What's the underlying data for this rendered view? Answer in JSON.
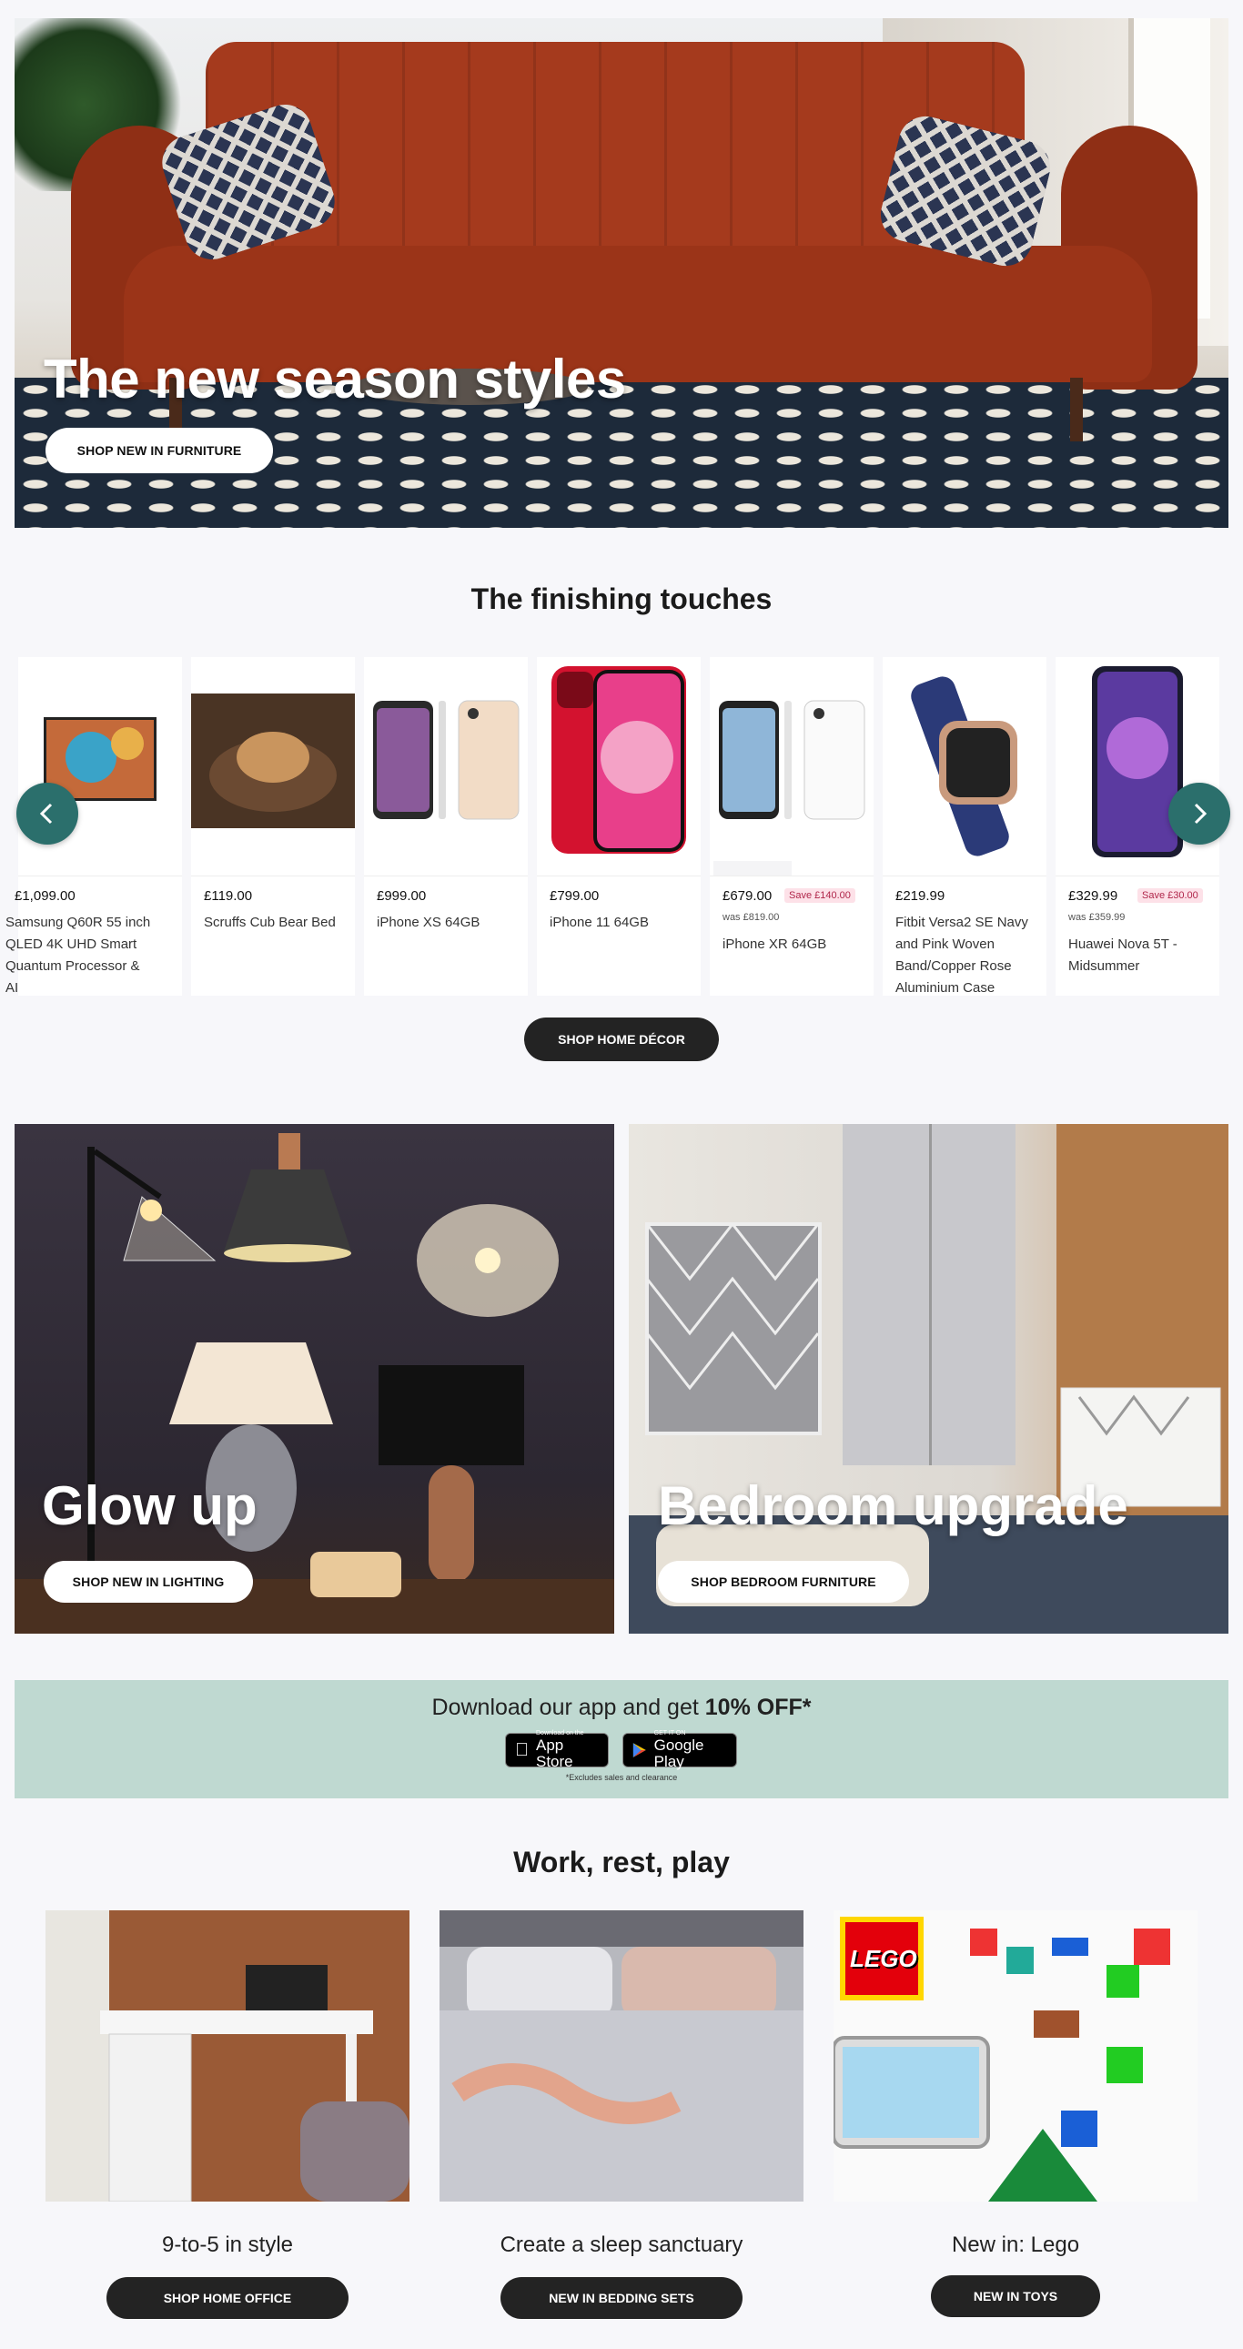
{
  "hero": {
    "heading": "The new season styles",
    "cta": "SHOP NEW IN FURNITURE"
  },
  "finishing": {
    "title": "The finishing touches",
    "products": [
      {
        "price": "£1,099.00",
        "name": "Samsung Q60R 55 inch QLED 4K UHD Smart Quantum Processor & AI"
      },
      {
        "price": "£119.00",
        "name": "Scruffs Cub Bear Bed"
      },
      {
        "price": "£999.00",
        "name": "iPhone XS 64GB"
      },
      {
        "price": "£799.00",
        "name": "iPhone 11 64GB"
      },
      {
        "price": "£679.00",
        "save": "Save £140.00",
        "was": "was £819.00",
        "name": "iPhone XR 64GB"
      },
      {
        "price": "£219.99",
        "name": "Fitbit Versa2 SE Navy and Pink Woven Band/Copper Rose Aluminium Case"
      },
      {
        "price": "£329.99",
        "save": "Save £30.00",
        "was": "was £359.99",
        "name": "Huawei Nova 5T - Midsummer"
      }
    ],
    "cta": "SHOP HOME DÉCOR",
    "prev_icon": "chevron-left-icon",
    "next_icon": "chevron-right-icon"
  },
  "tiles": [
    {
      "heading": "Glow up",
      "cta": "SHOP NEW IN LIGHTING"
    },
    {
      "heading": "Bedroom upgrade",
      "cta": "SHOP BEDROOM FURNITURE"
    }
  ],
  "app_banner": {
    "text_pre": "Download our app and get ",
    "text_bold": "10% OFF*",
    "app_store_small": "Download on the",
    "app_store_big": "App Store",
    "google_small": "GET IT ON",
    "google_big": "Google Play",
    "note": "*Excludes sales and clearance",
    "color": "#bfd9d1"
  },
  "work_rest_play": {
    "title": "Work, rest, play",
    "items": [
      {
        "caption": "9-to-5 in style",
        "cta": "SHOP HOME OFFICE"
      },
      {
        "caption": "Create a sleep sanctuary",
        "cta": "NEW IN BEDDING SETS"
      },
      {
        "caption": "New in: Lego",
        "cta": "NEW IN TOYS",
        "logo_text": "LEGO"
      }
    ]
  },
  "colors": {
    "accent_arrow": "#2b6f6c",
    "dark_button": "#232323",
    "sofa": "#a53a1d"
  }
}
